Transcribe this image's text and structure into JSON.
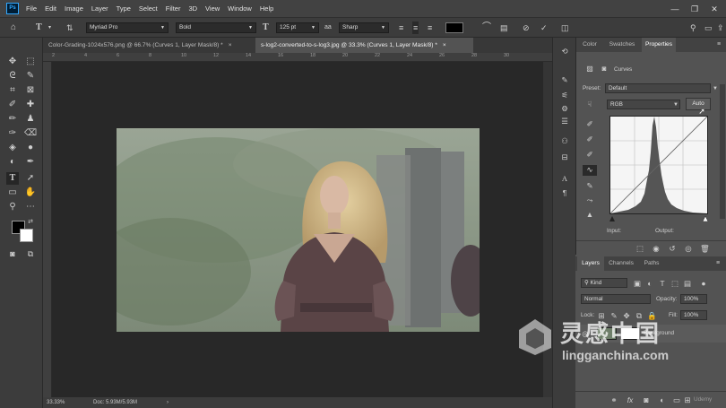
{
  "app": {
    "logo": "Ps"
  },
  "menu": [
    "File",
    "Edit",
    "Image",
    "Layer",
    "Type",
    "Select",
    "Filter",
    "3D",
    "View",
    "Window",
    "Help"
  ],
  "window_controls": {
    "minimize": "—",
    "restore": "❐",
    "close": "✕"
  },
  "options_bar": {
    "text_tool_icon": "T",
    "font_family": "Myriad Pro",
    "font_style": "Bold",
    "size_icon": "T",
    "font_size": "125 pt",
    "aa_icon": "aa",
    "antialias": "Sharp"
  },
  "doc_tabs": [
    {
      "label": "Color-Grading-1024x576.png @ 66.7% (Curves 1, Layer Mask/8) *",
      "close": "×"
    },
    {
      "label": "s-log2-converted-to-s-log3.jpg @ 33.3% (Curves 1, Layer Mask/8) *",
      "close": "×"
    }
  ],
  "ruler": {
    "top_ticks": [
      "2",
      "4",
      "6",
      "8",
      "10",
      "12",
      "14",
      "16",
      "18",
      "20",
      "22",
      "24",
      "26",
      "28",
      "30"
    ]
  },
  "status": {
    "zoom": "33.33%",
    "doc": "Doc: 5.93M/5.93M",
    "arrow": "›"
  },
  "properties_panel": {
    "tabs": [
      "Color",
      "Swatches",
      "Properties"
    ],
    "adjustment_title": "Curves",
    "preset_label": "Preset:",
    "preset_value": "Default",
    "channel_value": "RGB",
    "auto_label": "Auto",
    "input_label": "Input:",
    "output_label": "Output:"
  },
  "layers_panel": {
    "tabs": [
      "Layers",
      "Channels",
      "Paths"
    ],
    "kind_value": "Kind",
    "blend_mode": "Normal",
    "opacity_label": "Opacity:",
    "opacity_value": "100%",
    "lock_label": "Lock:",
    "fill_label": "Fill:",
    "fill_value": "100%",
    "layer_name": "Background",
    "footer_text": "Udemy"
  },
  "watermark": {
    "cn": "灵感中国",
    "en": "lingganchina.com"
  },
  "colors": {
    "accent": "#31a8ff",
    "panel_bg": "#535353",
    "canvas_bg": "#282828",
    "toolbar_bg": "#3c3c3c"
  }
}
